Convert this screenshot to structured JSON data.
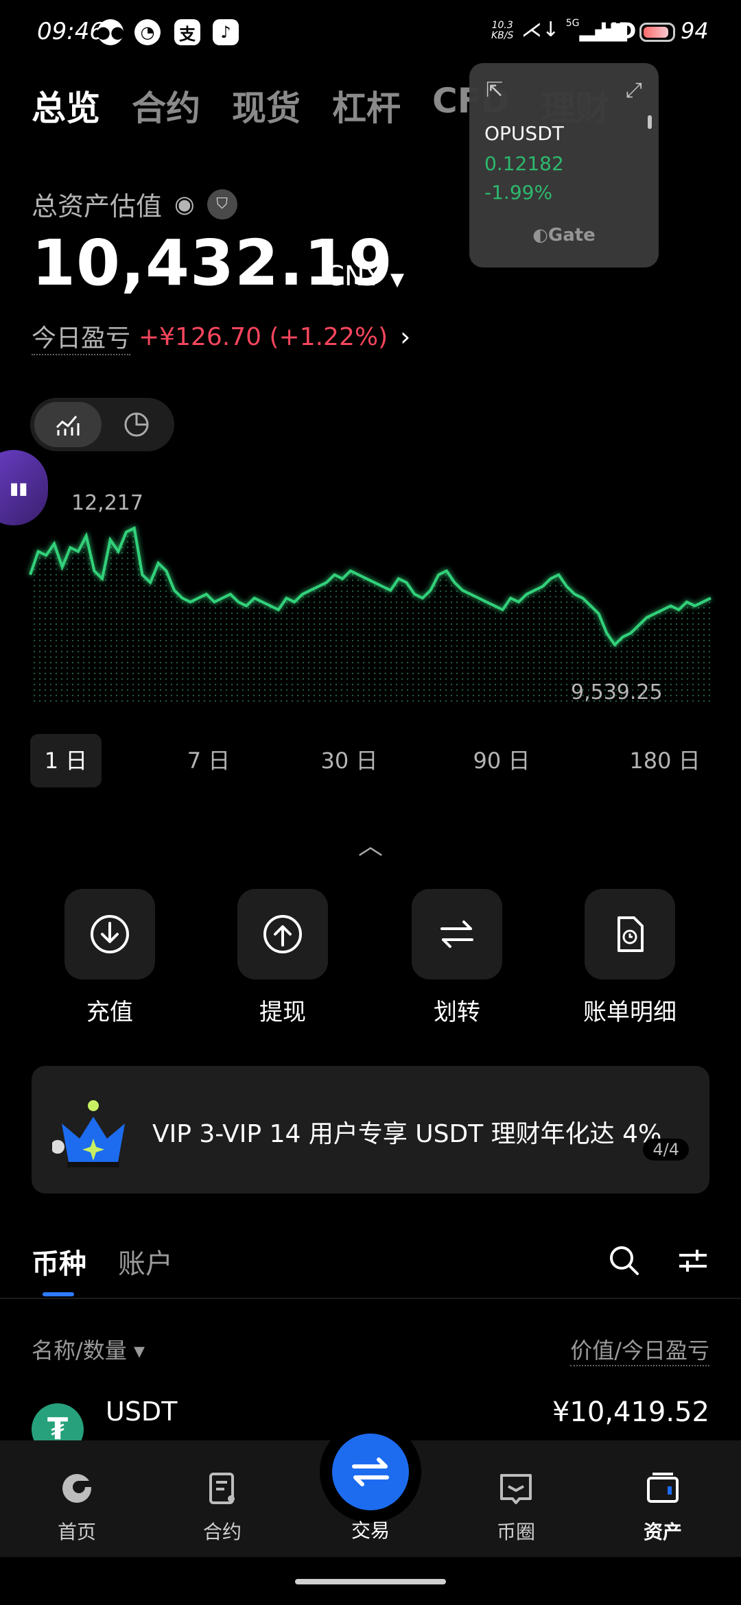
{
  "status": {
    "time": "09:46",
    "net_speed_top": "10.3",
    "net_speed_bottom": "KB/S",
    "signal": "5G",
    "hd": "HD",
    "battery": "94",
    "apps": [
      "WeChat",
      "Weibo",
      "Alipay",
      "TikTok"
    ]
  },
  "tabs": [
    "总览",
    "合约",
    "现货",
    "杠杆",
    "CFD",
    "理财"
  ],
  "widget": {
    "symbol": "OPUSDT",
    "price": "0.12182",
    "change": "-1.99%",
    "brand": "Gate"
  },
  "assets": {
    "label": "总资产估值",
    "total": "10,432.19",
    "currency": "CNY",
    "pnl_label": "今日盈亏",
    "pnl_value": "+¥126.70 (+1.22%)"
  },
  "chart_data": {
    "type": "area",
    "max_label": "12,217",
    "min_label": "9,539.25",
    "values": [
      11200,
      11500,
      11450,
      11600,
      11300,
      11550,
      11500,
      11700,
      11250,
      11150,
      11650,
      11500,
      11750,
      11800,
      11200,
      11100,
      11350,
      11250,
      11000,
      10900,
      10850,
      10900,
      10950,
      10850,
      10900,
      10950,
      10850,
      10800,
      10900,
      10850,
      10800,
      10750,
      10900,
      10850,
      10950,
      11000,
      11050,
      11100,
      11200,
      11150,
      11250,
      11200,
      11150,
      11100,
      11050,
      11000,
      11150,
      11100,
      10950,
      10900,
      11000,
      11200,
      11250,
      11100,
      11000,
      10950,
      10900,
      10850,
      10800,
      10750,
      10900,
      10850,
      10950,
      11000,
      11050,
      11150,
      11200,
      11050,
      10950,
      10900,
      10800,
      10700,
      10450,
      10300,
      10400,
      10450,
      10550,
      10650,
      10700,
      10750,
      10800,
      10750,
      10850,
      10800,
      10850,
      10900
    ],
    "ranges": [
      "1 日",
      "7 日",
      "30 日",
      "90 日",
      "180 日"
    ],
    "active_range": "1 日"
  },
  "actions": [
    {
      "label": "充值",
      "icon": "deposit-icon"
    },
    {
      "label": "提现",
      "icon": "withdraw-icon"
    },
    {
      "label": "划转",
      "icon": "transfer-icon"
    },
    {
      "label": "账单明细",
      "icon": "bill-icon"
    }
  ],
  "banner": {
    "text": "VIP 3-VIP 14 用户专享 USDT 理财年化达 4%",
    "page": "4/4"
  },
  "coin_tabs": {
    "active": "币种",
    "inactive": "账户"
  },
  "list": {
    "col_name": "名称/数量 ▾",
    "col_value": "价值/今日盈亏",
    "rows": [
      {
        "symbol": "USDT",
        "value": "¥10,419.52"
      }
    ]
  },
  "nav": {
    "home": "首页",
    "contract": "合约",
    "trade": "交易",
    "community": "币圈",
    "assets": "资产"
  },
  "colors": {
    "green": "#2fbf71",
    "red": "#f6465d",
    "blue": "#1d6cf0"
  }
}
